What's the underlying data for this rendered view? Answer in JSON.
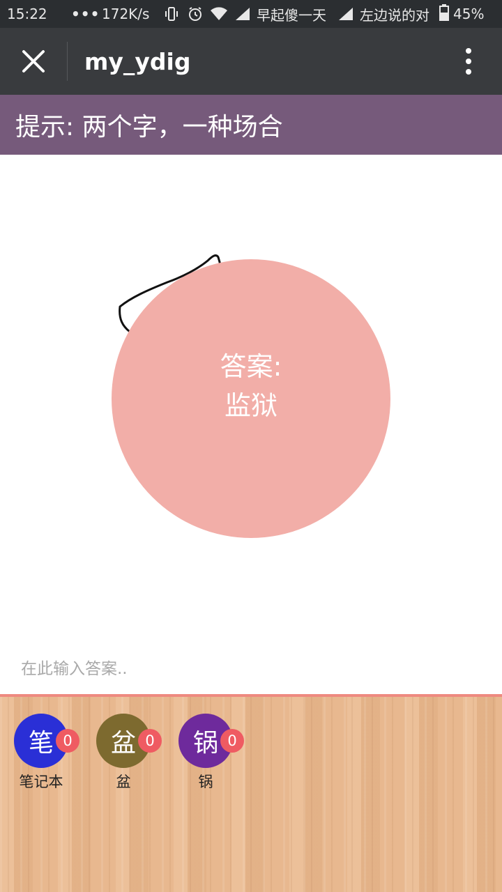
{
  "status_bar": {
    "time": "15:22",
    "more": "•••",
    "net_speed": "172K/s",
    "carrier_1": "早起傻一天",
    "carrier_2": "左边说的对",
    "battery": "45%",
    "icons": [
      "vibrate-icon",
      "alarm-icon",
      "wifi-icon",
      "signal-icon",
      "signal-icon",
      "battery-icon"
    ]
  },
  "title_bar": {
    "title": "my_ydig",
    "close_icon": "close-icon",
    "menu_icon": "more-vertical-icon"
  },
  "hint": {
    "text": "提示: 两个字，一种场合"
  },
  "answer": {
    "label": "答案:",
    "value": "监狱"
  },
  "input": {
    "placeholder": "在此输入答案..",
    "value": ""
  },
  "choices": [
    {
      "char": "笔",
      "badge": "0",
      "label": "笔记本",
      "color": "#2a2fd6"
    },
    {
      "char": "盆",
      "badge": "0",
      "label": "盆",
      "color": "#7d6a2f"
    },
    {
      "char": "锅",
      "badge": "0",
      "label": "锅",
      "color": "#6e2a9c"
    }
  ],
  "colors": {
    "hint_bar": "#765a7b",
    "answer_circle": "#f2aea8",
    "badge": "#ef5b62",
    "tray_border": "#ee8a80"
  }
}
